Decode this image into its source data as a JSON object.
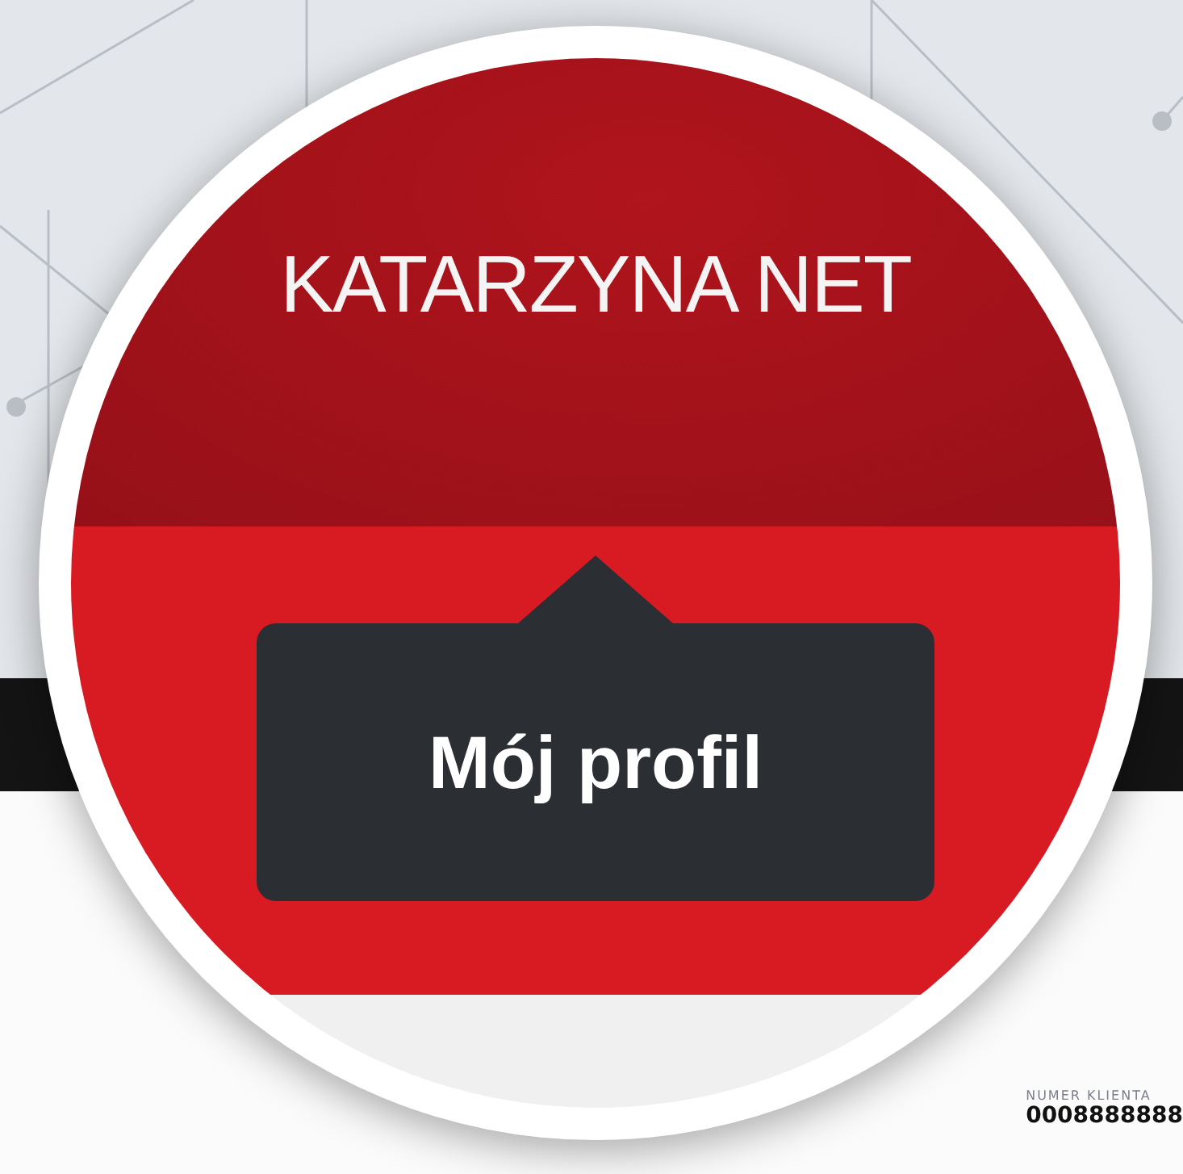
{
  "magnifier": {
    "header_name": "KATARZYNA NET",
    "tooltip": "Mój profil"
  },
  "client": {
    "label": "NUMER KLIENTA",
    "number": "0008888888"
  }
}
